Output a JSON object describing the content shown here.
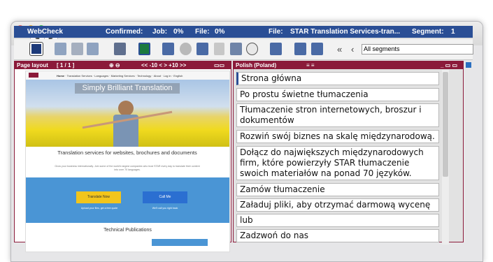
{
  "status": {
    "app": "WebCheck",
    "confirmed": "Confirmed:",
    "job_label": "Job:",
    "job_value": "0%",
    "file_label": "File:",
    "file_value": "0%",
    "file_name_label": "File:",
    "file_name": "STAR Translation Services-tran...",
    "segment_label": "Segment:",
    "segment_value": "1"
  },
  "toolbar": {
    "segments_select": "All segments",
    "nav_prev_glyph": "«"
  },
  "left_panel": {
    "title": "Page layout",
    "page_indicator": "[ 1 / 1 ]",
    "nav": "<<  -10  <  >  +10  >>",
    "zoom": "⊕ ⊖"
  },
  "website": {
    "menu": [
      "Home",
      "Translation Services",
      "Languages",
      "Marketing Services",
      "Technology",
      "About",
      "Log in",
      "English"
    ],
    "hero_title": "Simply Brilliant Translation",
    "headline": "Translation services for websites, brochures and documents",
    "body": "Grow your business internationally. Join some of the world's largest companies who trust STAR every day to translate their content into over 70 languages.",
    "btn_translate": "Translate Now",
    "btn_translate_sub": "Upload your files, get a free quote",
    "btn_call": "Call Me",
    "btn_call_sub": "We'll call you right back",
    "section2": "Technical Publications"
  },
  "right_panel": {
    "title": "Polish (Poland)",
    "segments": [
      "Strona główna",
      "Po prostu świetne tłumaczenia",
      "Tłumaczenie stron internetowych, broszur i dokumentów",
      "Rozwiń swój biznes na skalę międzynarodową.",
      "Dołącz do największych międzynarodowych firm, które powierzyły STAR tłumaczenie swoich materiałów na ponad 70 języków.",
      "Zamów tłumaczenie",
      "Załaduj pliki, aby otrzymać darmową wycenę",
      "lub",
      "Zadzwoń do nas"
    ]
  },
  "colors": {
    "status_blue": "#2a4e95",
    "panel_red": "#8b1a3a",
    "button_yellow": "#f2c51c",
    "button_blue": "#2b6fd1",
    "section_blue": "#4a95d5"
  }
}
